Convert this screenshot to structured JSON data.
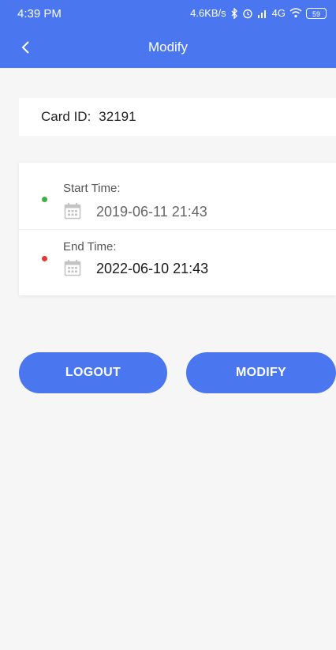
{
  "status_bar": {
    "time": "4:39 PM",
    "network_speed": "4.6KB/s",
    "network_type": "4G",
    "battery": "59"
  },
  "nav": {
    "title": "Modify",
    "back_icon": "chevron-left-icon"
  },
  "card": {
    "label": "Card ID:",
    "value": "32191"
  },
  "times": {
    "start": {
      "label": "Start Time:",
      "value": "2019-06-11 21:43",
      "dot_color": "#3cb043"
    },
    "end": {
      "label": "End Time:",
      "value": "2022-06-10 21:43",
      "dot_color": "#e53935"
    },
    "icon": "calendar-icon"
  },
  "buttons": {
    "logout_label": "LOGOUT",
    "modify_label": "MODIFY"
  },
  "colors": {
    "accent": "#4a77f0",
    "background": "#f6f6f7"
  }
}
